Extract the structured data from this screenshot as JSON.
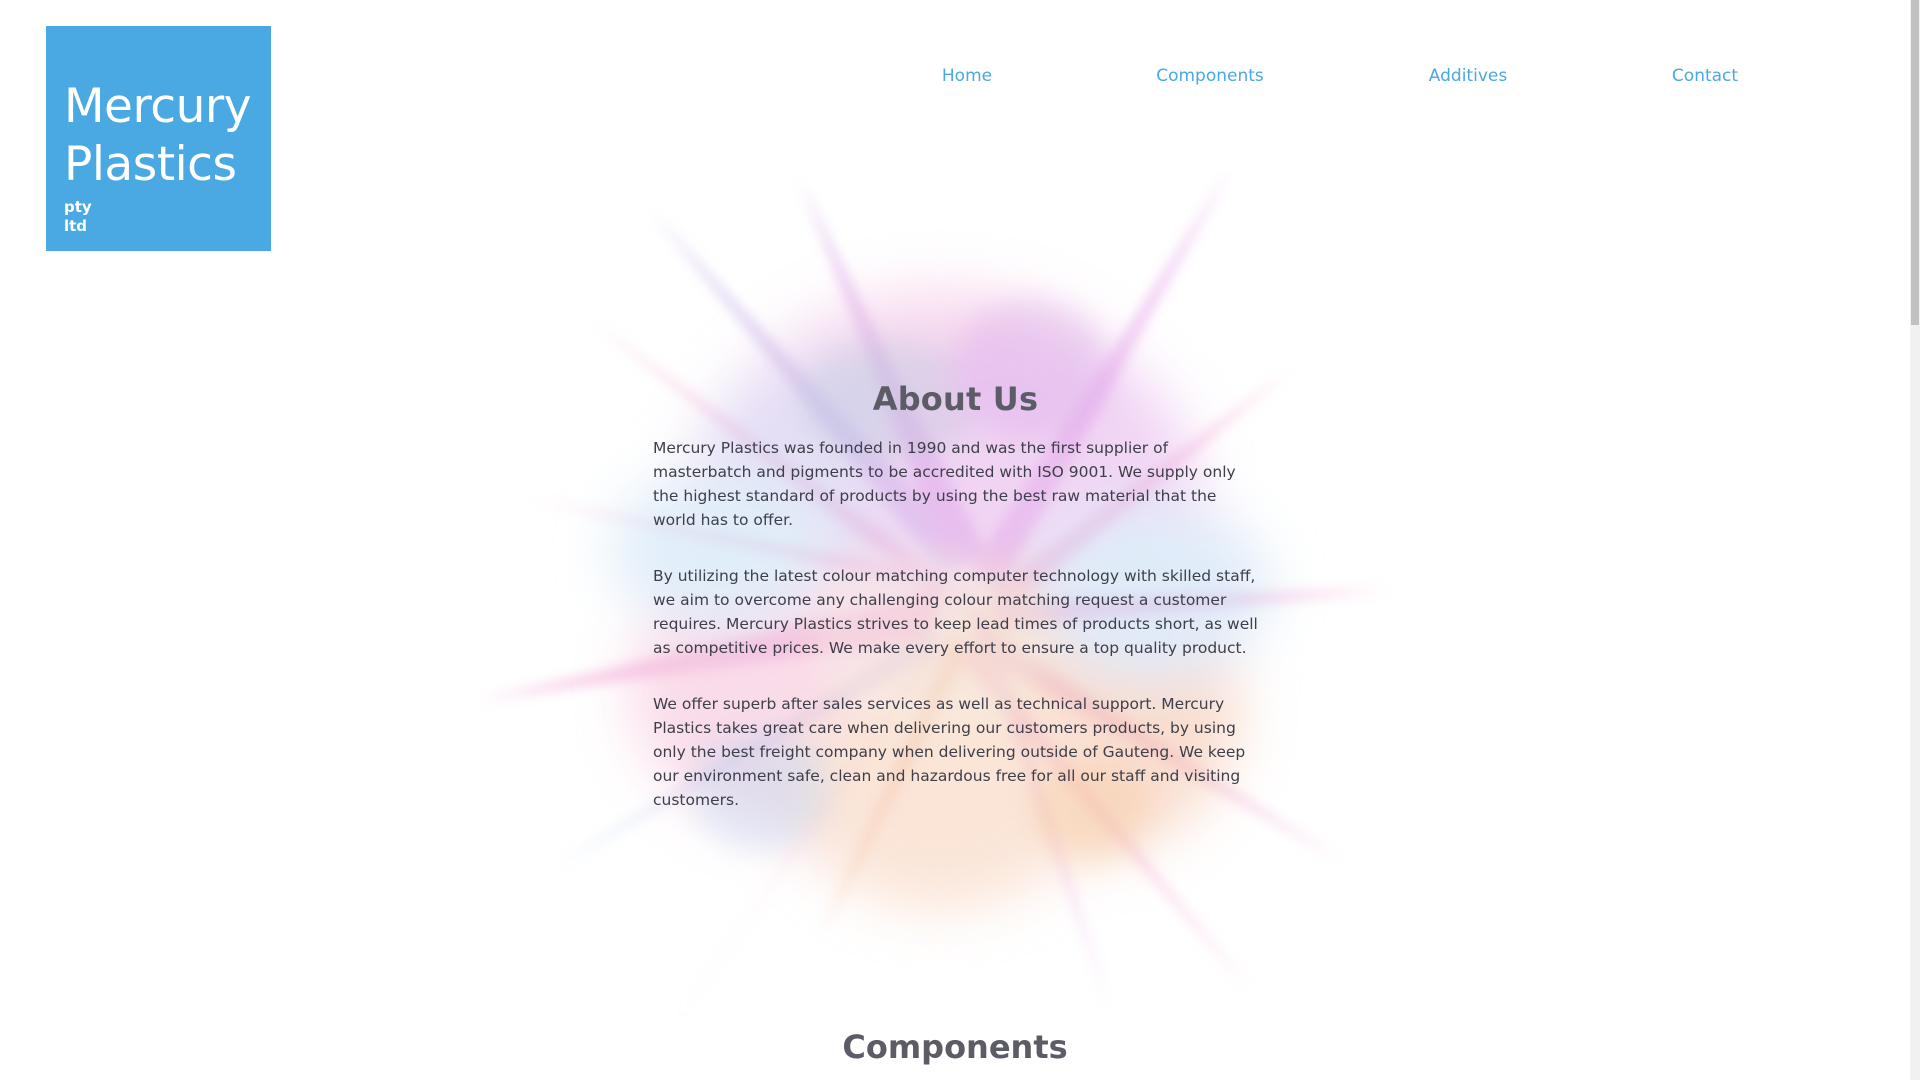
{
  "brand": {
    "line1": "Mercury",
    "line2": "Plastics",
    "sub1": "pty",
    "sub2": "ltd",
    "color": "#4aa8e2"
  },
  "nav": {
    "home": "Home",
    "components": "Components",
    "additives": "Additives",
    "contact": "Contact"
  },
  "about": {
    "title": "About Us",
    "paragraphs": [
      "Mercury Plastics was founded in 1990 and was the first supplier of masterbatch and pigments to be accredited with ISO 9001. We supply only the highest standard of products by using the best raw material that the world has to offer.",
      "By utilizing the latest colour matching computer technology with skilled staff, we aim to overcome any challenging colour matching request a customer requires. Mercury Plastics strives to keep lead times of products short, as well as competitive prices. We make every effort to ensure a top quality product.",
      "We offer superb after sales services as well as technical support. Mercury Plastics takes great care when delivering our customers products, by using only the best freight company when delivering outside of Gauteng. We keep our environment safe, clean and hazardous free for all our staff and visiting customers."
    ]
  },
  "components_section": {
    "title": "Components"
  },
  "colors": {
    "heading": "#5c5c66",
    "body_text": "#3e3f4a",
    "link": "#4aa8e2"
  }
}
